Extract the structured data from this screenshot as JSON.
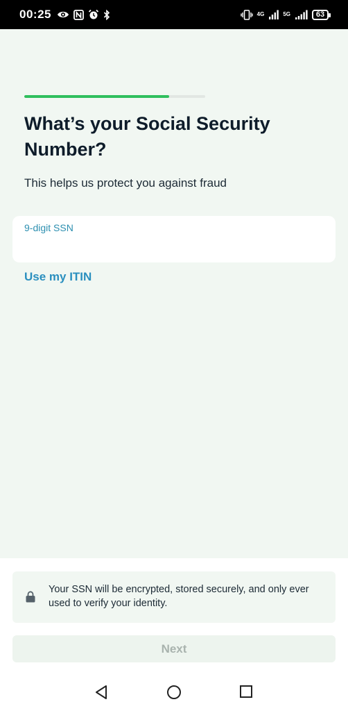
{
  "status_bar": {
    "time": "00:25",
    "icons_left": [
      "eye-icon",
      "nfc-icon",
      "alarm-icon",
      "bluetooth-icon"
    ],
    "network1": "4G",
    "network2": "5G",
    "battery": "63"
  },
  "progress": {
    "value": 0.8
  },
  "page": {
    "title": "What’s your Social Security Number?",
    "subtitle": "This helps us protect you against fraud"
  },
  "ssn_field": {
    "label": "9-digit SSN",
    "value": ""
  },
  "itin_link": "Use my ITIN",
  "info": {
    "icon": "lock-icon",
    "text": "Your SSN will be encrypted, stored securely, and only ever used to verify your identity."
  },
  "next_button": {
    "label": "Next",
    "enabled": false
  },
  "colors": {
    "accent_green": "#2fbf5d",
    "link_blue": "#2a8fbf",
    "background": "#f1f7f2"
  }
}
